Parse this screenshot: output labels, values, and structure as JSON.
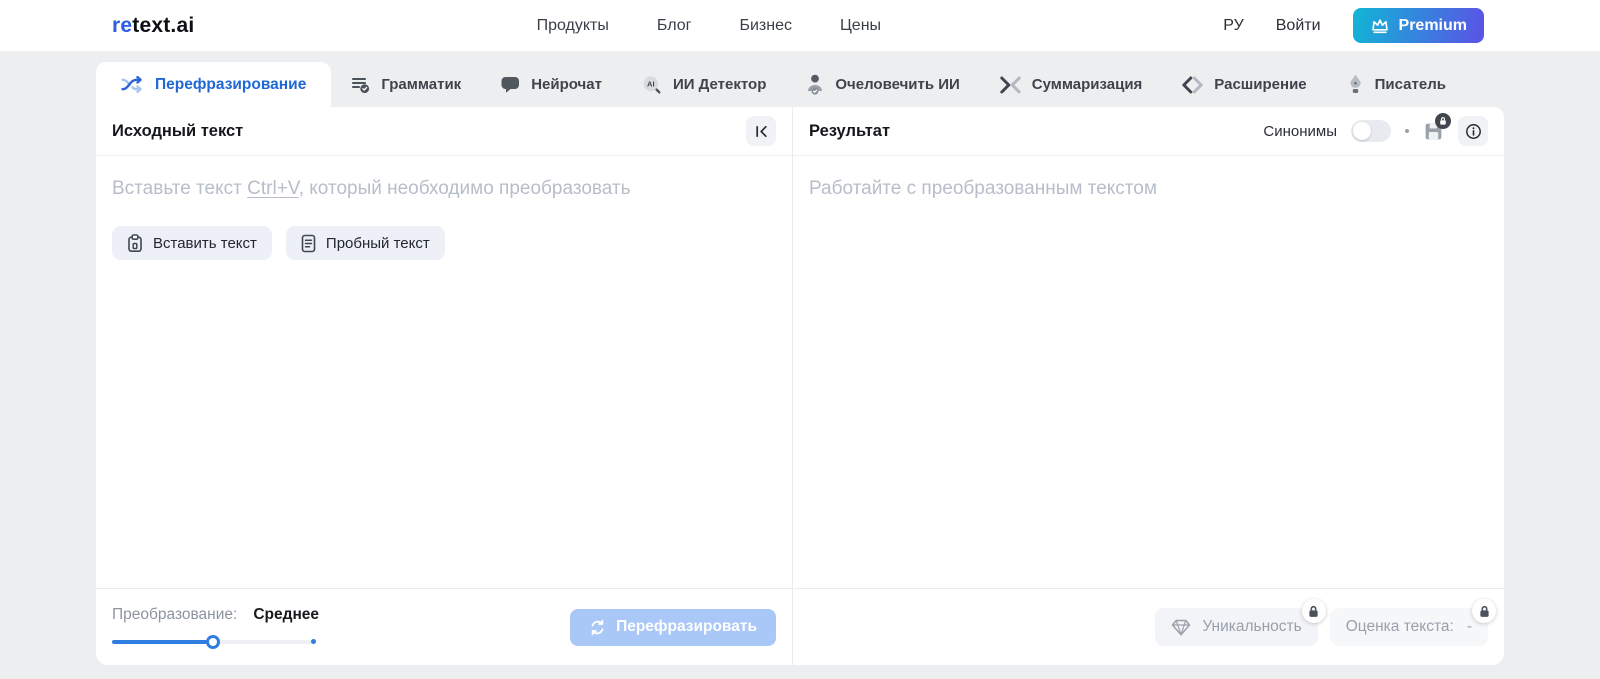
{
  "navbar": {
    "logo_re": "re",
    "logo_rest": "text.ai",
    "links": [
      "Продукты",
      "Блог",
      "Бизнес",
      "Цены"
    ],
    "language": "РУ",
    "login": "Войти",
    "premium_label": "Premium"
  },
  "tabs": [
    {
      "label": "Перефразирование",
      "icon": "shuffle-icon",
      "active": true
    },
    {
      "label": "Грамматик",
      "icon": "grammar-check-icon",
      "active": false
    },
    {
      "label": "Нейрочат",
      "icon": "chat-bubble-icon",
      "active": false
    },
    {
      "label": "ИИ Детектор",
      "icon": "ai-detector-icon",
      "active": false
    },
    {
      "label": "Очеловечить ИИ",
      "icon": "humanize-person-icon",
      "active": false
    },
    {
      "label": "Суммаризация",
      "icon": "summarize-arrows-icon",
      "active": false
    },
    {
      "label": "Расширение",
      "icon": "expand-arrows-icon",
      "active": false
    },
    {
      "label": "Писатель",
      "icon": "pen-nib-icon",
      "active": false
    }
  ],
  "source_panel": {
    "title": "Исходный текст",
    "placeholder_before": "Вставьте текст ",
    "placeholder_kbd": "Ctrl+V",
    "placeholder_after": ", который необходимо преобразовать",
    "paste_button": "Вставить текст",
    "sample_button": "Пробный текст"
  },
  "result_panel": {
    "title": "Результат",
    "synonyms_label": "Синонимы",
    "synonyms_enabled": false,
    "placeholder": "Работайте с преобразованным текстом"
  },
  "footer": {
    "transform_label": "Преобразование:",
    "transform_value": "Среднее",
    "slider_percent": 50,
    "paraphrase_button": "Перефразировать",
    "uniqueness_label": "Уникальность",
    "score_label": "Оценка текста:",
    "score_value": "-"
  },
  "colors": {
    "accent_blue": "#2a5fe3",
    "active_tab_text": "#1f68d6",
    "premium_gradient_start": "#11b5d6",
    "premium_gradient_end": "#5b52e5",
    "disabled_primary_button": "#a9c8f7",
    "slider_fill": "#2f7de1",
    "placeholder_text": "#b7bdc9"
  }
}
